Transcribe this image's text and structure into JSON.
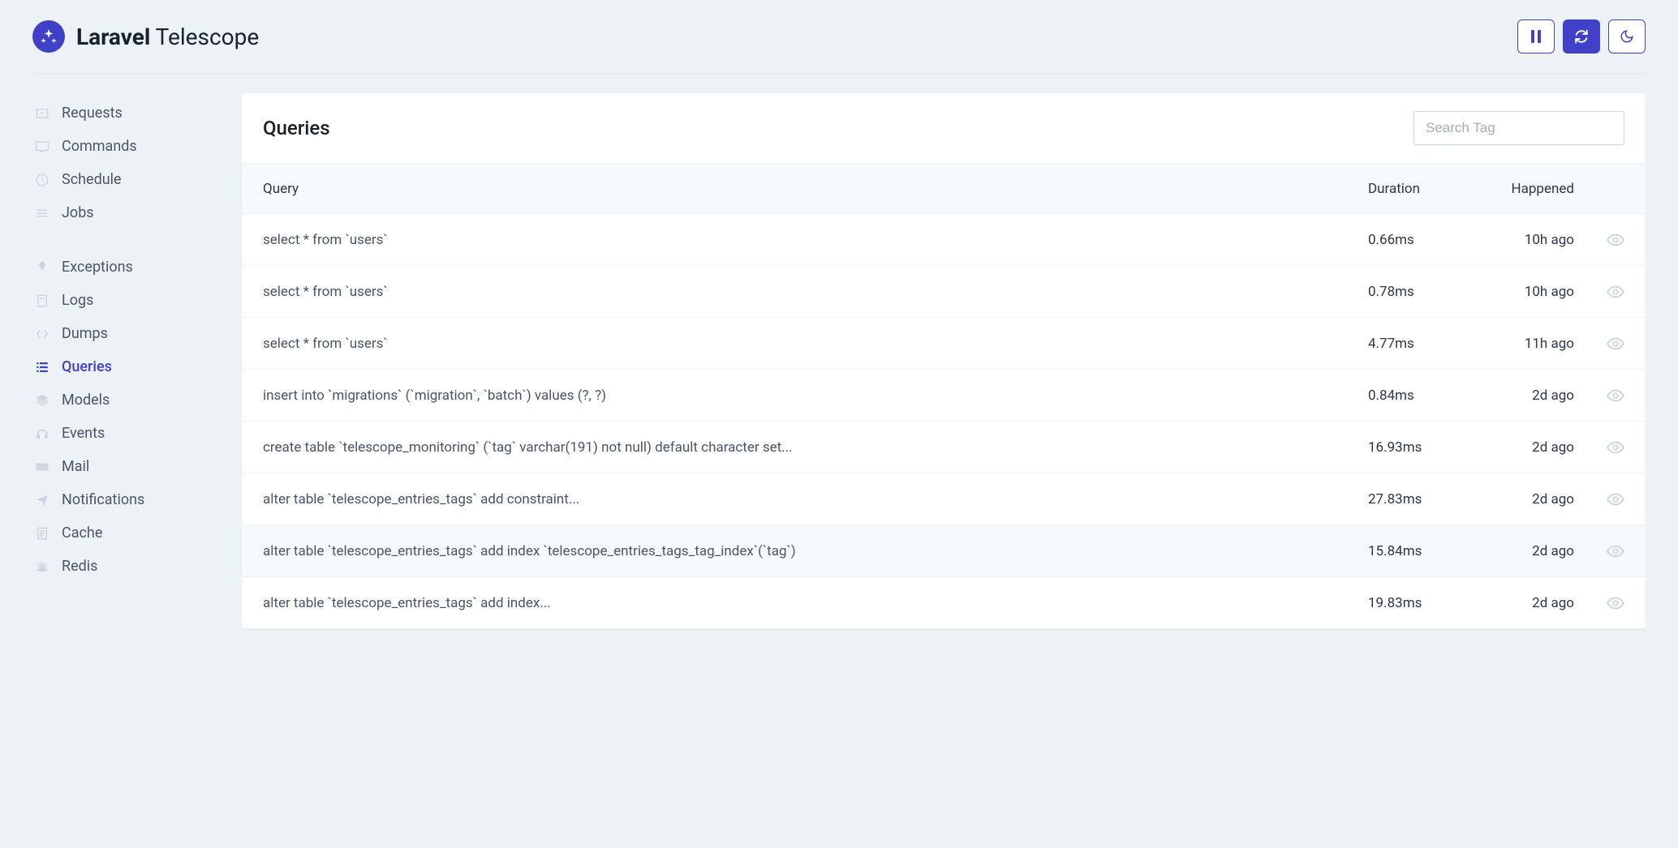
{
  "brand": {
    "bold": "Laravel",
    "light": "Telescope"
  },
  "search": {
    "placeholder": "Search Tag"
  },
  "panel": {
    "title": "Queries"
  },
  "columns": {
    "query": "Query",
    "duration": "Duration",
    "happened": "Happened"
  },
  "sidebar": {
    "group1": [
      {
        "label": "Requests",
        "icon": "requests-icon"
      },
      {
        "label": "Commands",
        "icon": "commands-icon"
      },
      {
        "label": "Schedule",
        "icon": "schedule-icon"
      },
      {
        "label": "Jobs",
        "icon": "jobs-icon"
      }
    ],
    "group2": [
      {
        "label": "Exceptions",
        "icon": "exceptions-icon"
      },
      {
        "label": "Logs",
        "icon": "logs-icon"
      },
      {
        "label": "Dumps",
        "icon": "dumps-icon"
      },
      {
        "label": "Queries",
        "icon": "queries-icon",
        "active": true
      },
      {
        "label": "Models",
        "icon": "models-icon"
      },
      {
        "label": "Events",
        "icon": "events-icon"
      },
      {
        "label": "Mail",
        "icon": "mail-icon"
      },
      {
        "label": "Notifications",
        "icon": "notifications-icon"
      },
      {
        "label": "Cache",
        "icon": "cache-icon"
      },
      {
        "label": "Redis",
        "icon": "redis-icon"
      }
    ]
  },
  "rows": [
    {
      "query": "select * from `users`",
      "duration": "0.66ms",
      "happened": "10h ago"
    },
    {
      "query": "select * from `users`",
      "duration": "0.78ms",
      "happened": "10h ago"
    },
    {
      "query": "select * from `users`",
      "duration": "4.77ms",
      "happened": "11h ago"
    },
    {
      "query": "insert into `migrations` (`migration`, `batch`) values (?, ?)",
      "duration": "0.84ms",
      "happened": "2d ago"
    },
    {
      "query": "create table `telescope_monitoring` (`tag` varchar(191) not null) default character set...",
      "duration": "16.93ms",
      "happened": "2d ago"
    },
    {
      "query": "alter table `telescope_entries_tags` add constraint...",
      "duration": "27.83ms",
      "happened": "2d ago"
    },
    {
      "query": "alter table `telescope_entries_tags` add index `telescope_entries_tags_tag_index`(`tag`)",
      "duration": "15.84ms",
      "happened": "2d ago",
      "alt": true
    },
    {
      "query": "alter table `telescope_entries_tags` add index...",
      "duration": "19.83ms",
      "happened": "2d ago"
    }
  ]
}
